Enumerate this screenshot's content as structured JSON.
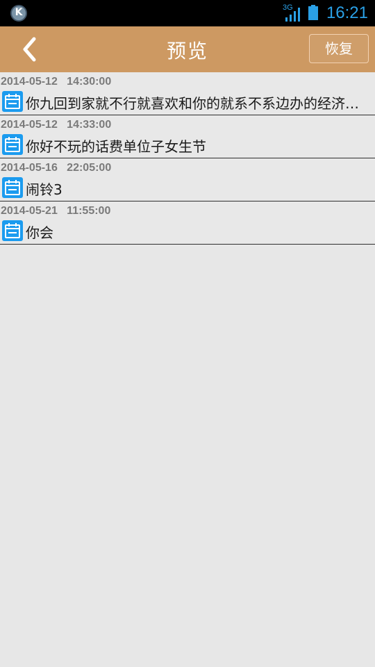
{
  "status": {
    "network": "3G",
    "time": "16:21",
    "accent": "#2aa0e6",
    "icons": [
      "app-k-icon",
      "signal-icon",
      "battery-icon"
    ]
  },
  "header": {
    "title": "预览",
    "back_icon": "chevron-left-icon",
    "restore_label": "恢复",
    "color": "#cd9962"
  },
  "items": [
    {
      "time": "2014-05-12   14:30:00",
      "text": "你九回到家就不行就喜欢和你的就系不系边办的经济…",
      "icon": "calendar-icon"
    },
    {
      "time": "2014-05-12   14:33:00",
      "text": "你好不玩的话费单位子女生节",
      "icon": "calendar-icon"
    },
    {
      "time": "2014-05-16   22:05:00",
      "text": "闹铃3",
      "icon": "calendar-icon"
    },
    {
      "time": "2014-05-21   11:55:00",
      "text": "你会",
      "icon": "calendar-icon"
    }
  ]
}
